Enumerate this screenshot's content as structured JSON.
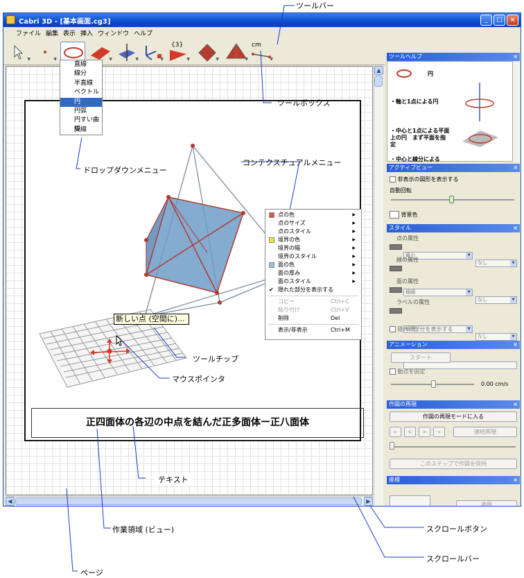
{
  "window": {
    "title": "Cabri 3D - [基本画面.cg3]",
    "minimize": "_",
    "maximize": "□",
    "close": "×"
  },
  "menubar": [
    "ファイル",
    "編集",
    "表示",
    "挿入",
    "ウィンドウ",
    "ヘルプ"
  ],
  "toolbar": {
    "icons": [
      "pointer-tool",
      "point-tool",
      "circle-tool",
      "plane-tool",
      "perpendicular-tool",
      "vector-tool",
      "transform-tool",
      "triangle-tool",
      "polyhedron-tool",
      "pyramid-tool",
      "measure-tool"
    ],
    "labels": {
      "transform": "{3}",
      "measure": "cm"
    }
  },
  "dropdown": {
    "items": [
      "直線",
      "線分",
      "半直線",
      "ベクトル",
      "円",
      "円弧",
      "円すい曲線",
      "交線"
    ],
    "selected": "円"
  },
  "context_menu": {
    "items": [
      {
        "label": "点の色",
        "swatch": "#d45a3c",
        "submenu": true
      },
      {
        "label": "点のサイズ",
        "submenu": true
      },
      {
        "label": "点のスタイル",
        "submenu": true
      },
      {
        "label": "境界の色",
        "swatch": "#f4e43c",
        "submenu": true
      },
      {
        "label": "境界の幅",
        "submenu": true
      },
      {
        "label": "境界のスタイル",
        "submenu": true
      },
      {
        "label": "面の色",
        "swatch": "#8ec4ec",
        "submenu": true
      },
      {
        "label": "面の厚み",
        "submenu": true
      },
      {
        "label": "面のスタイル",
        "submenu": true
      },
      {
        "label": "隠れた部分を表示する",
        "checked": true
      }
    ],
    "actions": [
      {
        "label": "コピー",
        "shortcut": "Ctrl+C",
        "disabled": true
      },
      {
        "label": "貼り付け",
        "shortcut": "Ctrl+V",
        "disabled": true
      },
      {
        "label": "削除",
        "shortcut": "Del",
        "disabled": false
      }
    ],
    "toggle": {
      "label": "表示/非表示",
      "shortcut": "Ctrl+M"
    }
  },
  "tooltip": "新しい点 (空間に)...",
  "caption": "正四面体の各辺の中点を結んだ正多面体ー正八面体",
  "panels": {
    "toolhelp": {
      "title": "ツールヘルプ",
      "heading": "円",
      "items": [
        "・軸と1点による円",
        "・中心と1点による平面上の円　まず平面を指定",
        "・中心と線分による"
      ]
    },
    "activeview": {
      "title": "アクティブビュー",
      "show_hidden": "非表示の図形を表示する",
      "auto_rotate": "自動回転",
      "bg_color": "背景色"
    },
    "style": {
      "title": "スタイル",
      "point_attr": "点の属性",
      "point_size": "最小",
      "point_style": "なし",
      "line_attr": "線の属性",
      "line_width": "極細",
      "line_style": "なし",
      "face_attr": "面の属性",
      "face_thick": "極薄",
      "face_style": "なし",
      "label_attr": "ラベルの属性",
      "show_hidden": "隠れた部分を表示する"
    },
    "animation": {
      "title": "アニメーション",
      "start": "スタート",
      "fix_point": "動点を固定",
      "speed": "0.00 cm/s"
    },
    "replay": {
      "title": "作図の再現",
      "enter": "作図の再現モードに入る",
      "nav": [
        "«",
        "<",
        ">",
        "»"
      ],
      "continuous": "連続再現",
      "keep": "このステップで作図を保持"
    },
    "coords": {
      "title": "座標",
      "apply": "適用"
    }
  },
  "annotations": {
    "toolbar": "ツールバー",
    "toolbox": "ツールボックス",
    "dropdown": "ドロップダウンメニュー",
    "context": "コンテクスチュアルメニュー",
    "tooltip": "ツールチップ",
    "pointer": "マウスポインタ",
    "text": "テキスト",
    "workarea": "作業領域 (ビュー)",
    "scrollbtn": "スクロールボタン",
    "scrollbar": "スクロールバー",
    "page": "ページ"
  }
}
